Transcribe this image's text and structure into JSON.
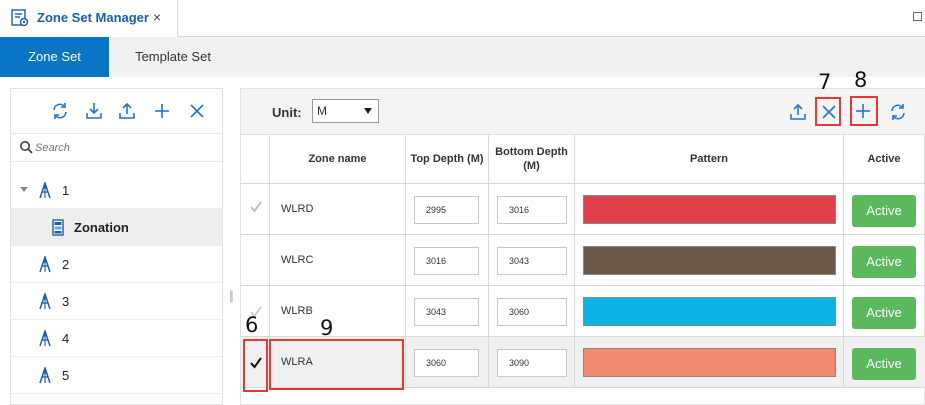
{
  "window": {
    "tab_title": "Zone Set Manager",
    "close_glyph": "×"
  },
  "subtabs": {
    "active": "Zone Set",
    "inactive": "Template Set"
  },
  "left": {
    "search_placeholder": "Search",
    "tree": [
      {
        "label": "1",
        "icon": "rig-icon",
        "expanded": true
      },
      {
        "label": "Zonation",
        "icon": "zonation-icon",
        "selected": true
      },
      {
        "label": "2",
        "icon": "rig-icon"
      },
      {
        "label": "3",
        "icon": "rig-icon"
      },
      {
        "label": "4",
        "icon": "rig-icon"
      },
      {
        "label": "5",
        "icon": "rig-icon"
      }
    ]
  },
  "right": {
    "unit_label": "Unit:",
    "unit_value": "M",
    "columns": {
      "zone_name": "Zone name",
      "top_depth": "Top Depth (M)",
      "bottom_depth": "Bottom Depth (M)",
      "pattern": "Pattern",
      "active": "Active"
    },
    "rows": [
      {
        "name": "WLRD",
        "top": "2995",
        "bottom": "3016",
        "color": "#e0404a",
        "active": "Active",
        "checked": false
      },
      {
        "name": "WLRC",
        "top": "3016",
        "bottom": "3043",
        "color": "#6b5848",
        "active": "Active",
        "checked": false
      },
      {
        "name": "WLRB",
        "top": "3043",
        "bottom": "3060",
        "color": "#0db3e5",
        "active": "Active",
        "checked": false
      },
      {
        "name": "WLRA",
        "top": "3060",
        "bottom": "3090",
        "color": "#f08a70",
        "active": "Active",
        "checked": true
      }
    ]
  },
  "annotations": {
    "n6": "6",
    "n7": "7",
    "n8": "8",
    "n9": "9",
    "color": "#e53935"
  }
}
